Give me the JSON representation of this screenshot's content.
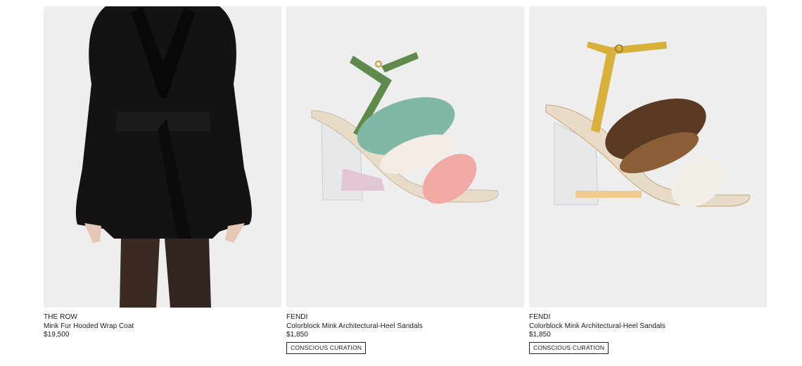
{
  "products": [
    {
      "designer": "THE ROW",
      "name": "Mink Fur Hooded Wrap Coat",
      "price": "$19,500",
      "badge": ""
    },
    {
      "designer": "FENDI",
      "name": "Colorblock Mink Architectural-Heel Sandals",
      "price": "$1,850",
      "badge": "CONSCIOUS CURATION"
    },
    {
      "designer": "FENDI",
      "name": "Colorblock Mink Architectural-Heel Sandals",
      "price": "$1,850",
      "badge": "CONSCIOUS CURATION"
    }
  ],
  "colors": {
    "image_bg": "#eeeeef",
    "text": "#1a1a1a"
  }
}
